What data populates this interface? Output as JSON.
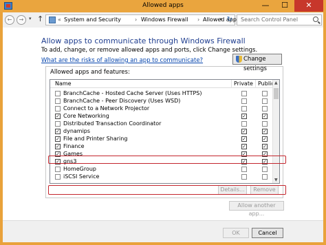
{
  "window": {
    "title": "Allowed apps",
    "controls": {
      "minimize": "—",
      "maximize": "☐",
      "close": "✕"
    }
  },
  "address": {
    "prefix": "«",
    "crumbs": [
      "System and Security",
      "Windows Firewall",
      "Allowed apps"
    ],
    "separator": "›",
    "dropdown": "▾",
    "refresh": "↻",
    "search_placeholder": "Search Control Panel"
  },
  "nav": {
    "back": "←",
    "forward": "→",
    "dropdown": "▾",
    "up": "↑"
  },
  "main": {
    "heading": "Allow apps to communicate through Windows Firewall",
    "subtext": "To add, change, or remove allowed apps and ports, click Change settings.",
    "risk_link": "What are the risks of allowing an app to communicate?",
    "change_settings": "Change settings"
  },
  "apps": {
    "group_title": "Allowed apps and features:",
    "columns": {
      "name": "Name",
      "private": "Private",
      "public": "Public"
    },
    "check_glyph": "✓",
    "rows": [
      {
        "name": "BranchCache - Hosted Cache Server (Uses HTTPS)",
        "enabled": false,
        "private": false,
        "public": false
      },
      {
        "name": "BranchCache - Peer Discovery (Uses WSD)",
        "enabled": false,
        "private": false,
        "public": false
      },
      {
        "name": "Connect to a Network Projector",
        "enabled": false,
        "private": false,
        "public": false
      },
      {
        "name": "Core Networking",
        "enabled": true,
        "private": true,
        "public": true
      },
      {
        "name": "Distributed Transaction Coordinator",
        "enabled": false,
        "private": false,
        "public": false
      },
      {
        "name": "dynamips",
        "enabled": true,
        "private": true,
        "public": true
      },
      {
        "name": "File and Printer Sharing",
        "enabled": true,
        "private": true,
        "public": true
      },
      {
        "name": "Finance",
        "enabled": true,
        "private": true,
        "public": true
      },
      {
        "name": "Games",
        "enabled": true,
        "private": true,
        "public": true
      },
      {
        "name": "gns3",
        "enabled": true,
        "private": true,
        "public": true
      },
      {
        "name": "HomeGroup",
        "enabled": false,
        "private": false,
        "public": false
      },
      {
        "name": "iSCSI Service",
        "enabled": false,
        "private": false,
        "public": false
      }
    ],
    "details_button": "Details...",
    "remove_button": "Remove"
  },
  "scroll": {
    "up": "▲",
    "down": "▼"
  },
  "footer": {
    "allow_another": "Allow another app...",
    "ok": "OK",
    "cancel": "Cancel"
  },
  "colors": {
    "titlebar": "#eaa53e",
    "close_button": "#c7372b",
    "heading": "#1e3d8f",
    "link": "#0645ad",
    "highlight_box": "#c3242c"
  }
}
